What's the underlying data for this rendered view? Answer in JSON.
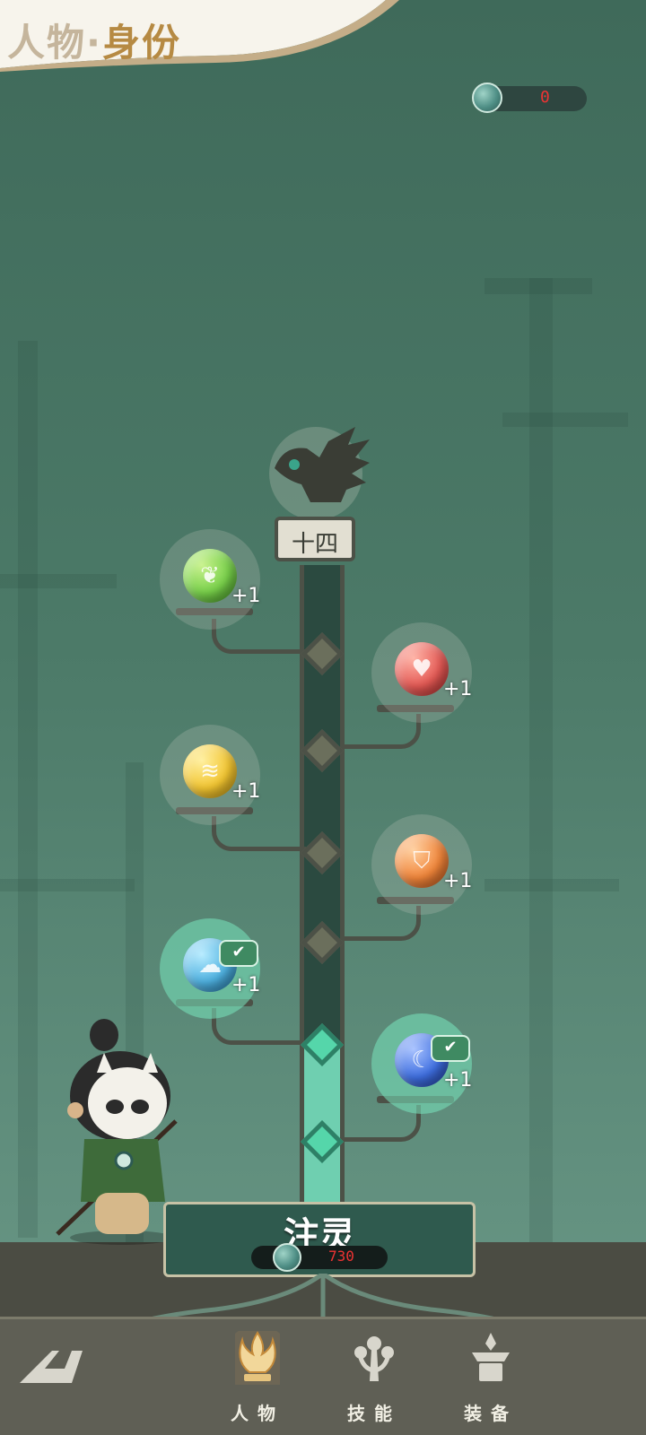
{
  "header": {
    "title_prefix": "人物·",
    "title_main": "身份"
  },
  "currency": {
    "icon": "jade-coin-icon",
    "value": "0"
  },
  "tree": {
    "level": "十四",
    "emblem_icon": "bird-totem-icon",
    "orbs": [
      {
        "icon": "leaf-orb-icon",
        "color": "#78d04a",
        "bonus": "+1",
        "unlocked": false
      },
      {
        "icon": "heart-orb-icon",
        "color": "#e45a55",
        "bonus": "+1",
        "unlocked": false
      },
      {
        "icon": "claw-orb-icon",
        "color": "#f2c531",
        "bonus": "+1",
        "unlocked": false
      },
      {
        "icon": "shield-orb-icon",
        "color": "#f0853a",
        "bonus": "+1",
        "unlocked": false
      },
      {
        "icon": "wind-orb-icon",
        "color": "#4fb1e0",
        "bonus": "+1",
        "unlocked": true
      },
      {
        "icon": "moon-orb-icon",
        "color": "#3f6fe0",
        "bonus": "+1",
        "unlocked": true
      }
    ],
    "fill_fraction": 0.27
  },
  "infuse": {
    "label": "注灵",
    "cost": "730",
    "cost_icon": "jade-coin-icon"
  },
  "nav": {
    "back_icon": "back-arrow-icon",
    "items": [
      {
        "label": "人物",
        "icon": "character-flame-icon",
        "active": true
      },
      {
        "label": "技能",
        "icon": "skill-branch-icon",
        "active": false
      },
      {
        "label": "装备",
        "icon": "equipment-anvil-icon",
        "active": false
      }
    ]
  },
  "character": {
    "icon": "masked-warrior-avatar"
  }
}
